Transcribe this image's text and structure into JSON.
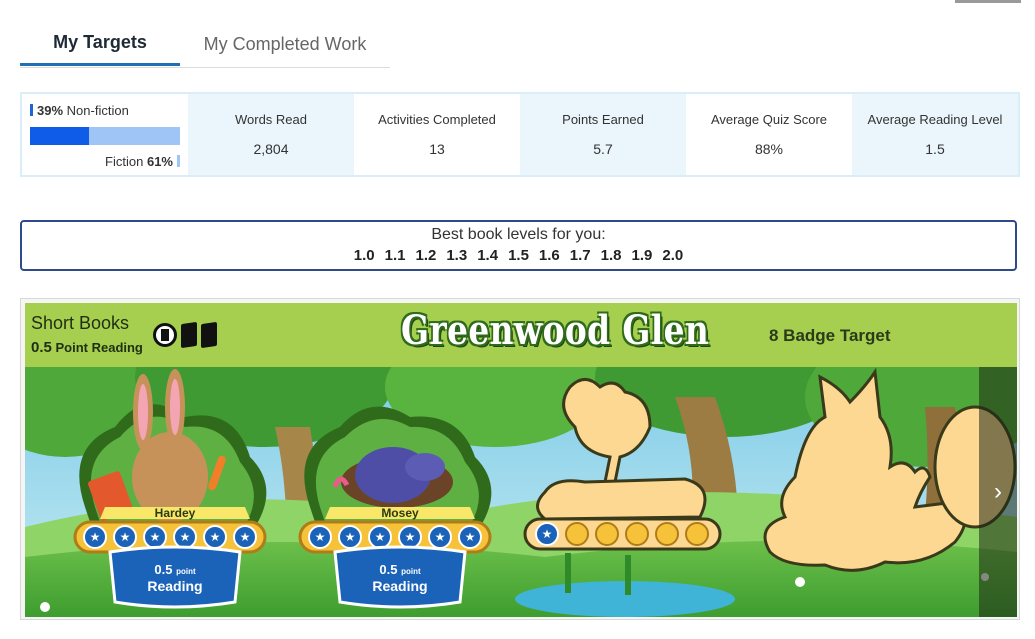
{
  "tabs": [
    {
      "label": "My Targets",
      "active": true
    },
    {
      "label": "My Completed Work",
      "active": false
    }
  ],
  "genre": {
    "nonfiction_pct": "39%",
    "nonfiction_label": "Non-fiction",
    "fiction_label": "Fiction",
    "fiction_pct": "61%",
    "nonfiction_fraction": 0.39
  },
  "stats": [
    {
      "label": "Words Read",
      "value": "2,804"
    },
    {
      "label": "Activities Completed",
      "value": "13"
    },
    {
      "label": "Points Earned",
      "value": "5.7"
    },
    {
      "label": "Average Quiz Score",
      "value": "88%"
    },
    {
      "label": "Average Reading Level",
      "value": "1.5"
    }
  ],
  "levels": {
    "title": "Best book levels for you:",
    "values": [
      "1.0",
      "1.1",
      "1.2",
      "1.3",
      "1.4",
      "1.5",
      "1.6",
      "1.7",
      "1.8",
      "1.9",
      "2.0"
    ]
  },
  "banner": {
    "category": "Short Books",
    "points_value": "0.5",
    "points_label": "Point Reading",
    "world_title": "Greenwood Glen",
    "badge_target": "8 Badge Target",
    "badges": [
      {
        "name": "Hardey",
        "ribbon_points": "0.5",
        "ribbon_unit": "point",
        "ribbon_label": "Reading",
        "state": "earned",
        "tokens": 6
      },
      {
        "name": "Mosey",
        "ribbon_points": "0.5",
        "ribbon_unit": "point",
        "ribbon_label": "Reading",
        "state": "earned",
        "tokens": 6
      },
      {
        "name": "",
        "state": "in-progress",
        "tokens_earned": 1,
        "tokens_total": 6
      },
      {
        "name": "",
        "state": "locked"
      }
    ]
  },
  "colors": {
    "accent_blue": "#1f6fb5",
    "header_green": "#a7cf4f",
    "ribbon_blue": "#1b63b8",
    "badge_gold": "#f6c23a",
    "locked_silhouette": "#fcd892"
  },
  "icons": {
    "next": "chevron-right-icon",
    "books": "book-icon"
  }
}
